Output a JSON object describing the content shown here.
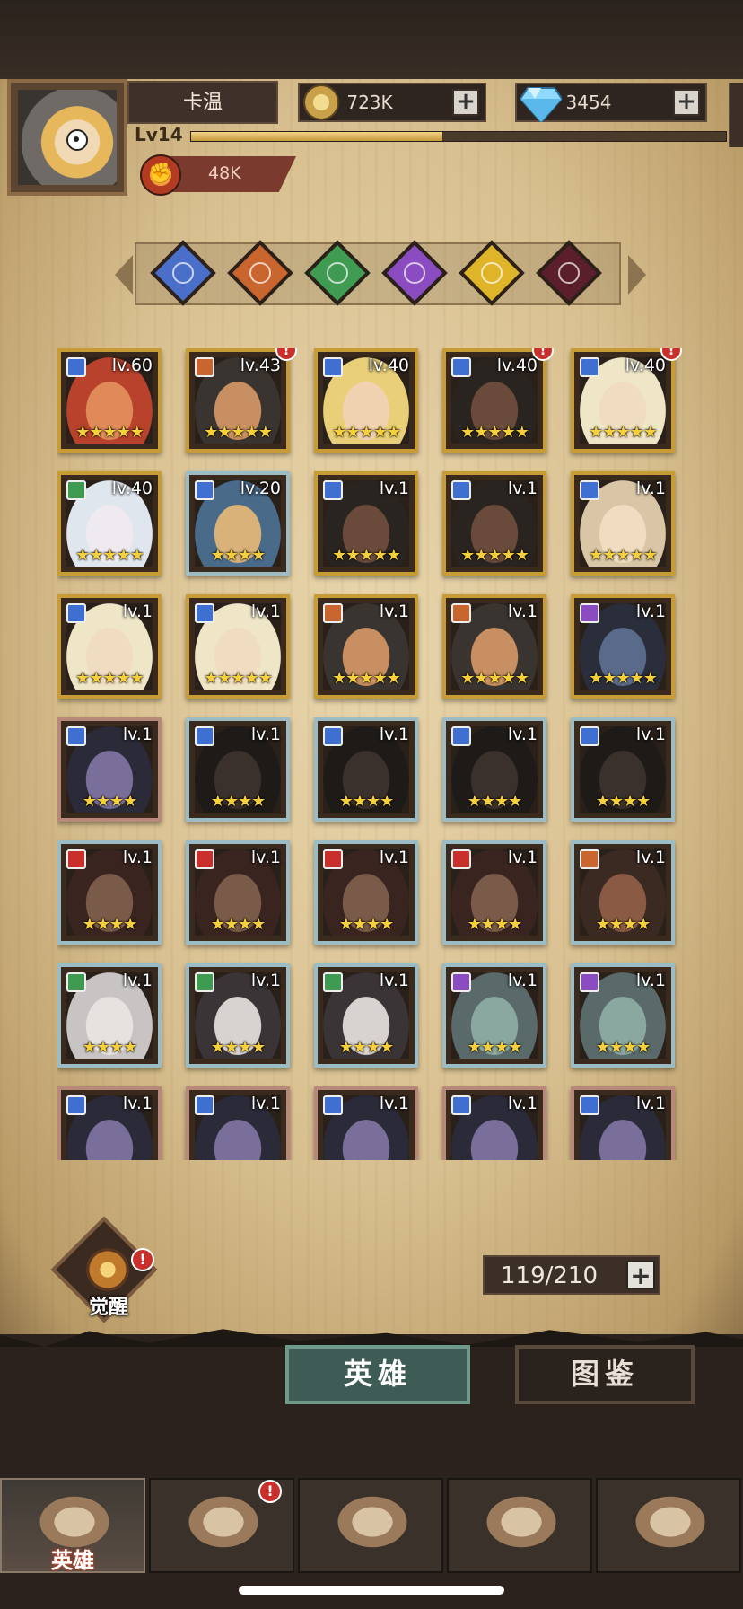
{
  "player": {
    "name": "卡温",
    "level": "Lv14",
    "power": "48K",
    "xp_fraction": 0.47
  },
  "resources": {
    "gold": "723K",
    "diamonds": "3454"
  },
  "filters": [
    {
      "name": "tech",
      "color": "#4a6fc8"
    },
    {
      "name": "order",
      "color": "#c9652e"
    },
    {
      "name": "nature",
      "color": "#3f9a52"
    },
    {
      "name": "arcane",
      "color": "#8a4cc0"
    },
    {
      "name": "light",
      "color": "#e0b428"
    },
    {
      "name": "shadow",
      "color": "#5a1f2b"
    }
  ],
  "heroes": [
    {
      "lv": "lv.60",
      "stars": "★★★★★",
      "rarity": "gold",
      "cls": "#3f6fd0",
      "alert": false,
      "skin": "#e08a5a",
      "hair": "#b8422c"
    },
    {
      "lv": "lv.43",
      "stars": "★★★★★",
      "rarity": "gold",
      "cls": "#c9652e",
      "alert": true,
      "skin": "#c89062",
      "hair": "#3a3430"
    },
    {
      "lv": "lv.40",
      "stars": "★★★★★",
      "rarity": "gold",
      "cls": "#3f6fd0",
      "alert": false,
      "skin": "#f1d2b0",
      "hair": "#e8cf78"
    },
    {
      "lv": "lv.40",
      "stars": "★★★★★",
      "rarity": "gold",
      "cls": "#3f6fd0",
      "alert": true,
      "skin": "#6a4a3a",
      "hair": "#2a2420"
    },
    {
      "lv": "lv.40",
      "stars": "★★★★★",
      "rarity": "gold",
      "cls": "#3f6fd0",
      "alert": true,
      "skin": "#f0dcc0",
      "hair": "#efe6c8"
    },
    {
      "lv": "lv.40",
      "stars": "★★★★★",
      "rarity": "gold",
      "cls": "#3f9a52",
      "alert": false,
      "skin": "#eeeaf0",
      "hair": "#dfe6ee"
    },
    {
      "lv": "lv.20",
      "stars": "★★★★",
      "rarity": "blue",
      "cls": "#3f6fd0",
      "alert": false,
      "skin": "#d9b27a",
      "hair": "#4a6a8a"
    },
    {
      "lv": "lv.1",
      "stars": "★★★★★",
      "rarity": "gold",
      "cls": "#3f6fd0",
      "alert": false,
      "skin": "#6a4a3a",
      "hair": "#2a2420"
    },
    {
      "lv": "lv.1",
      "stars": "★★★★★",
      "rarity": "gold",
      "cls": "#3f6fd0",
      "alert": false,
      "skin": "#6a4a3a",
      "hair": "#2a2420"
    },
    {
      "lv": "lv.1",
      "stars": "★★★★★",
      "rarity": "gold",
      "cls": "#3f6fd0",
      "alert": false,
      "skin": "#f0dcc0",
      "hair": "#d8c6a6"
    },
    {
      "lv": "lv.1",
      "stars": "★★★★★",
      "rarity": "gold",
      "cls": "#3f6fd0",
      "alert": false,
      "skin": "#f0dcc0",
      "hair": "#efe6c8"
    },
    {
      "lv": "lv.1",
      "stars": "★★★★★",
      "rarity": "gold",
      "cls": "#3f6fd0",
      "alert": false,
      "skin": "#f0dcc0",
      "hair": "#efe6c8"
    },
    {
      "lv": "lv.1",
      "stars": "★★★★★",
      "rarity": "gold",
      "cls": "#c9652e",
      "alert": false,
      "skin": "#c89062",
      "hair": "#3a3430"
    },
    {
      "lv": "lv.1",
      "stars": "★★★★★",
      "rarity": "gold",
      "cls": "#c9652e",
      "alert": false,
      "skin": "#c89062",
      "hair": "#3a3430"
    },
    {
      "lv": "lv.1",
      "stars": "★★★★★",
      "rarity": "gold",
      "cls": "#8a4cc0",
      "alert": false,
      "skin": "#5a6a8a",
      "hair": "#2a2e3a"
    },
    {
      "lv": "lv.1",
      "stars": "★★★★",
      "rarity": "copper",
      "cls": "#3f6fd0",
      "alert": false,
      "skin": "#7a6f9a",
      "hair": "#2a2a38"
    },
    {
      "lv": "lv.1",
      "stars": "★★★★",
      "rarity": "blue",
      "cls": "#3f6fd0",
      "alert": false,
      "skin": "#3a302c",
      "hair": "#1e1a18"
    },
    {
      "lv": "lv.1",
      "stars": "★★★★",
      "rarity": "blue",
      "cls": "#3f6fd0",
      "alert": false,
      "skin": "#3a302c",
      "hair": "#1e1a18"
    },
    {
      "lv": "lv.1",
      "stars": "★★★★",
      "rarity": "blue",
      "cls": "#3f6fd0",
      "alert": false,
      "skin": "#3a302c",
      "hair": "#1e1a18"
    },
    {
      "lv": "lv.1",
      "stars": "★★★★",
      "rarity": "blue",
      "cls": "#3f6fd0",
      "alert": false,
      "skin": "#3a302c",
      "hair": "#1e1a18"
    },
    {
      "lv": "lv.1",
      "stars": "★★★★",
      "rarity": "blue",
      "cls": "#c9302c",
      "alert": false,
      "skin": "#7a5a48",
      "hair": "#3a2420"
    },
    {
      "lv": "lv.1",
      "stars": "★★★★",
      "rarity": "blue",
      "cls": "#c9302c",
      "alert": false,
      "skin": "#7a5a48",
      "hair": "#3a2420"
    },
    {
      "lv": "lv.1",
      "stars": "★★★★",
      "rarity": "blue",
      "cls": "#c9302c",
      "alert": false,
      "skin": "#7a5a48",
      "hair": "#3a2420"
    },
    {
      "lv": "lv.1",
      "stars": "★★★★",
      "rarity": "blue",
      "cls": "#c9302c",
      "alert": false,
      "skin": "#7a5a48",
      "hair": "#3a2420"
    },
    {
      "lv": "lv.1",
      "stars": "★★★★",
      "rarity": "blue",
      "cls": "#c9652e",
      "alert": false,
      "skin": "#8a5a44",
      "hair": "#3a2a22"
    },
    {
      "lv": "lv.1",
      "stars": "★★★★",
      "rarity": "blue",
      "cls": "#3f9a52",
      "alert": false,
      "skin": "#e6e2e0",
      "hair": "#c8c4c4"
    },
    {
      "lv": "lv.1",
      "stars": "★★★★",
      "rarity": "blue",
      "cls": "#3f9a52",
      "alert": false,
      "skin": "#d8d2d0",
      "hair": "#3a3436"
    },
    {
      "lv": "lv.1",
      "stars": "★★★★",
      "rarity": "blue",
      "cls": "#3f9a52",
      "alert": false,
      "skin": "#d8d2d0",
      "hair": "#3a3436"
    },
    {
      "lv": "lv.1",
      "stars": "★★★★",
      "rarity": "blue",
      "cls": "#8a4cc0",
      "alert": false,
      "skin": "#8aa8a0",
      "hair": "#5a6a6a"
    },
    {
      "lv": "lv.1",
      "stars": "★★★★",
      "rarity": "blue",
      "cls": "#8a4cc0",
      "alert": false,
      "skin": "#8aa8a0",
      "hair": "#5a6a6a"
    },
    {
      "lv": "lv.1",
      "stars": "★★★★",
      "rarity": "copper",
      "cls": "#3f6fd0",
      "alert": false,
      "skin": "#7a6f9a",
      "hair": "#2a2a38"
    },
    {
      "lv": "lv.1",
      "stars": "★★★★",
      "rarity": "copper",
      "cls": "#3f6fd0",
      "alert": false,
      "skin": "#7a6f9a",
      "hair": "#2a2a38"
    },
    {
      "lv": "lv.1",
      "stars": "★★★★",
      "rarity": "copper",
      "cls": "#3f6fd0",
      "alert": false,
      "skin": "#7a6f9a",
      "hair": "#2a2a38"
    },
    {
      "lv": "lv.1",
      "stars": "★★★★",
      "rarity": "copper",
      "cls": "#3f6fd0",
      "alert": false,
      "skin": "#7a6f9a",
      "hair": "#2a2a38"
    },
    {
      "lv": "lv.1",
      "stars": "★★★★",
      "rarity": "copper",
      "cls": "#3f6fd0",
      "alert": false,
      "skin": "#7a6f9a",
      "hair": "#2a2a38"
    }
  ],
  "awaken": {
    "label": "觉醒"
  },
  "capacity": "119/210",
  "tabs": {
    "heroes": "英雄",
    "codex": "图鉴"
  },
  "nav": [
    {
      "name": "heroes",
      "label": "英雄",
      "icon": "helmet-icon"
    },
    {
      "name": "voyage",
      "label": "",
      "icon": "ship-wheel-flag-icon"
    },
    {
      "name": "battle",
      "label": "",
      "icon": "crossed-swords-icon"
    },
    {
      "name": "castle",
      "label": "",
      "icon": "castle-icon"
    },
    {
      "name": "guild",
      "label": "",
      "icon": "handshake-crest-icon"
    }
  ]
}
